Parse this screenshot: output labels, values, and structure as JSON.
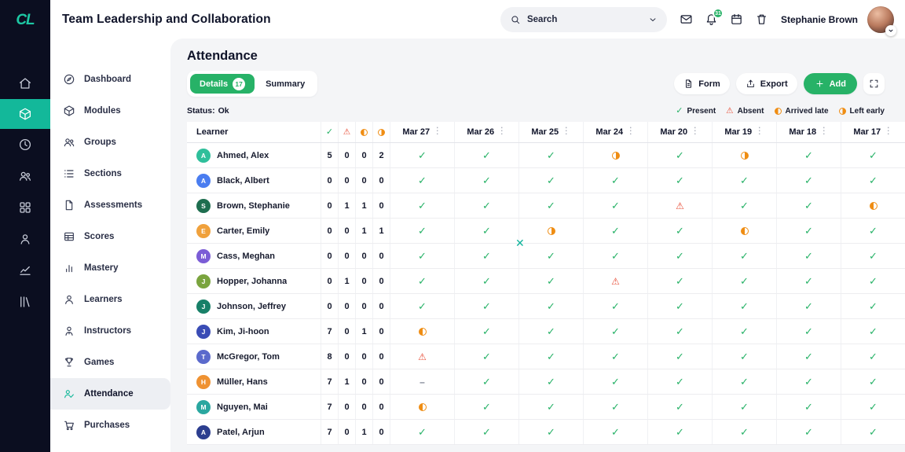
{
  "colors": {
    "green": "#27b267",
    "teal": "#13b89a",
    "orange": "#ef8d13",
    "red": "#e8503a"
  },
  "brand": {
    "logo": "CL"
  },
  "header": {
    "title": "Team Leadership and Collaboration",
    "search_placeholder": "Search",
    "notifications_badge": "31",
    "user_name": "Stephanie Brown"
  },
  "rail": {
    "items": [
      {
        "icon": "home",
        "active": false
      },
      {
        "icon": "modules",
        "active": true
      },
      {
        "icon": "dial",
        "active": false
      },
      {
        "icon": "groups",
        "active": false
      },
      {
        "icon": "apps",
        "active": false
      },
      {
        "icon": "user",
        "active": false
      },
      {
        "icon": "chart",
        "active": false
      },
      {
        "icon": "library",
        "active": false
      }
    ]
  },
  "sidebar": {
    "items": [
      {
        "label": "Dashboard",
        "icon": "dashboard",
        "active": false
      },
      {
        "label": "Modules",
        "icon": "modules",
        "active": false
      },
      {
        "label": "Groups",
        "icon": "groups",
        "active": false
      },
      {
        "label": "Sections",
        "icon": "sections",
        "active": false
      },
      {
        "label": "Assessments",
        "icon": "assessments",
        "active": false
      },
      {
        "label": "Scores",
        "icon": "scores",
        "active": false
      },
      {
        "label": "Mastery",
        "icon": "mastery",
        "active": false
      },
      {
        "label": "Learners",
        "icon": "learners",
        "active": false
      },
      {
        "label": "Instructors",
        "icon": "instructors",
        "active": false
      },
      {
        "label": "Games",
        "icon": "games",
        "active": false
      },
      {
        "label": "Attendance",
        "icon": "attendance",
        "active": true
      },
      {
        "label": "Purchases",
        "icon": "purchases",
        "active": false
      }
    ]
  },
  "page": {
    "title": "Attendance",
    "tabs": [
      {
        "label": "Details",
        "badge": "17",
        "active": true
      },
      {
        "label": "Summary",
        "active": false
      }
    ],
    "actions": [
      {
        "label": "Form",
        "icon": "form"
      },
      {
        "label": "Export",
        "icon": "export"
      },
      {
        "label": "Add",
        "icon": "plus"
      },
      {
        "label": "",
        "icon": "expand"
      }
    ],
    "status_label": "Status:",
    "status_value": "Ok",
    "legend": [
      {
        "mark": "present",
        "label": "Present"
      },
      {
        "mark": "absent",
        "label": "Absent"
      },
      {
        "mark": "late",
        "label": "Arrived late"
      },
      {
        "mark": "early",
        "label": "Left early"
      }
    ]
  },
  "attendance_table": {
    "learner_header": "Learner",
    "count_headers": [
      "present",
      "absent",
      "late",
      "early"
    ],
    "dates": [
      "Mar 27",
      "Mar 26",
      "Mar 25",
      "Mar 24",
      "Mar 20",
      "Mar 19",
      "Mar 18",
      "Mar 17"
    ],
    "rows": [
      {
        "name": "Ahmed, Alex",
        "initial": "A",
        "color": "#2fbf9b",
        "counts": [
          5,
          0,
          0,
          2
        ],
        "marks": [
          "present",
          "present",
          "present",
          "early",
          "present",
          "early",
          "present",
          "present"
        ]
      },
      {
        "name": "Black, Albert",
        "initial": "A",
        "color": "#4a7df0",
        "counts": [
          0,
          0,
          0,
          0
        ],
        "marks": [
          "present",
          "present",
          "present",
          "present",
          "present",
          "present",
          "present",
          "present"
        ]
      },
      {
        "name": "Brown, Stephanie",
        "initial": "S",
        "color": "#1e6e4f",
        "counts": [
          0,
          1,
          1,
          0
        ],
        "marks": [
          "present",
          "present",
          "present",
          "present",
          "absent",
          "present",
          "present",
          "late"
        ]
      },
      {
        "name": "Carter, Emily",
        "initial": "E",
        "color": "#f0a13c",
        "counts": [
          0,
          0,
          1,
          1
        ],
        "marks": [
          "present",
          "present",
          "early",
          "present",
          "present",
          "late",
          "present",
          "present"
        ]
      },
      {
        "name": "Cass, Meghan",
        "initial": "M",
        "color": "#7b5dd6",
        "counts": [
          0,
          0,
          0,
          0
        ],
        "marks": [
          "present",
          "present",
          "present",
          "present",
          "present",
          "present",
          "present",
          "present"
        ]
      },
      {
        "name": "Hopper, Johanna",
        "initial": "J",
        "color": "#7aa43e",
        "counts": [
          0,
          1,
          0,
          0
        ],
        "marks": [
          "present",
          "present",
          "present",
          "absent",
          "present",
          "present",
          "present",
          "present"
        ]
      },
      {
        "name": "Johnson, Jeffrey",
        "initial": "J",
        "color": "#188068",
        "counts": [
          0,
          0,
          0,
          0
        ],
        "marks": [
          "present",
          "present",
          "present",
          "present",
          "present",
          "present",
          "present",
          "present"
        ]
      },
      {
        "name": "Kim, Ji-hoon",
        "initial": "J",
        "color": "#3a4cb5",
        "counts": [
          7,
          0,
          1,
          0
        ],
        "marks": [
          "late",
          "present",
          "present",
          "present",
          "present",
          "present",
          "present",
          "present"
        ]
      },
      {
        "name": "McGregor, Tom",
        "initial": "T",
        "color": "#5b6acc",
        "counts": [
          8,
          0,
          0,
          0
        ],
        "marks": [
          "absent",
          "present",
          "present",
          "present",
          "present",
          "present",
          "present",
          "present"
        ]
      },
      {
        "name": "Müller, Hans",
        "initial": "H",
        "color": "#ef9232",
        "counts": [
          7,
          1,
          0,
          0
        ],
        "marks": [
          "none",
          "present",
          "present",
          "present",
          "present",
          "present",
          "present",
          "present"
        ]
      },
      {
        "name": "Nguyen, Mai",
        "initial": "M",
        "color": "#2aa7a0",
        "counts": [
          7,
          0,
          0,
          0
        ],
        "marks": [
          "late",
          "present",
          "present",
          "present",
          "present",
          "present",
          "present",
          "present"
        ]
      },
      {
        "name": "Patel, Arjun",
        "initial": "A",
        "color": "#2c3e8f",
        "counts": [
          7,
          0,
          1,
          0
        ],
        "marks": [
          "present",
          "present",
          "present",
          "present",
          "present",
          "present",
          "present",
          "present"
        ]
      }
    ]
  },
  "overlay": {
    "cursor_glyph": "✕"
  }
}
